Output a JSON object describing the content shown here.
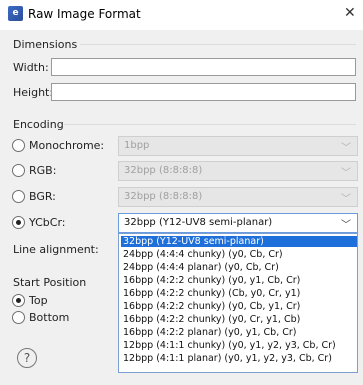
{
  "window": {
    "title": "Raw Image Format",
    "icon": "app-icon",
    "icon_letter": "e",
    "close_glyph": "✕"
  },
  "dimensions": {
    "label": "Dimensions",
    "width_label": "Width:",
    "width_value": "",
    "height_label": "Height:",
    "height_value": ""
  },
  "encoding": {
    "label": "Encoding",
    "options": [
      {
        "label": "Monochrome:",
        "selected": false,
        "combo_value": "1bpp",
        "enabled": false
      },
      {
        "label": "RGB:",
        "selected": false,
        "combo_value": "32bpp (8:8:8:8)",
        "enabled": false
      },
      {
        "label": "BGR:",
        "selected": false,
        "combo_value": "32bpp (8:8:8:8)",
        "enabled": false
      },
      {
        "label": "YCbCr:",
        "selected": true,
        "combo_value": "32bpp (Y12-UV8 semi-planar)",
        "enabled": true
      }
    ],
    "line_alignment_label": "Line alignment:"
  },
  "start_position": {
    "label": "Start Position",
    "top_label": "Top",
    "top_selected": true,
    "bottom_label": "Bottom",
    "bottom_selected": false
  },
  "ycbcr_dropdown": {
    "selected_index": 0,
    "items": [
      "32bpp (Y12-UV8 semi-planar)",
      "24bpp (4:4:4 chunky) (y0, Cb, Cr)",
      "24bpp (4:4:4 planar) (y0, Cb, Cr)",
      "16bpp (4:2:2 chunky) (y0, y1, Cb, Cr)",
      "16bpp (4:2:2 chunky) (Cb, y0, Cr, y1)",
      "16bpp (4:2:2 chunky) (y0, Cb, y1, Cr)",
      "16bpp (4:2:2 chunky) (y0, Cr, y1, Cb)",
      "16bpp (4:2:2 planar) (y0, y1, Cb, Cr)",
      "12bpp (4:1:1 chunky) (y0, y1, y2, y3, Cb, Cr)",
      "12bpp (4:1:1 planar) (y0, y1, y2, y3, Cb, Cr)"
    ]
  },
  "help": {
    "glyph": "?",
    "icon": "help-icon"
  },
  "colors": {
    "accent": "#1e6fd9",
    "dialog_bg": "#f0f0f0"
  }
}
